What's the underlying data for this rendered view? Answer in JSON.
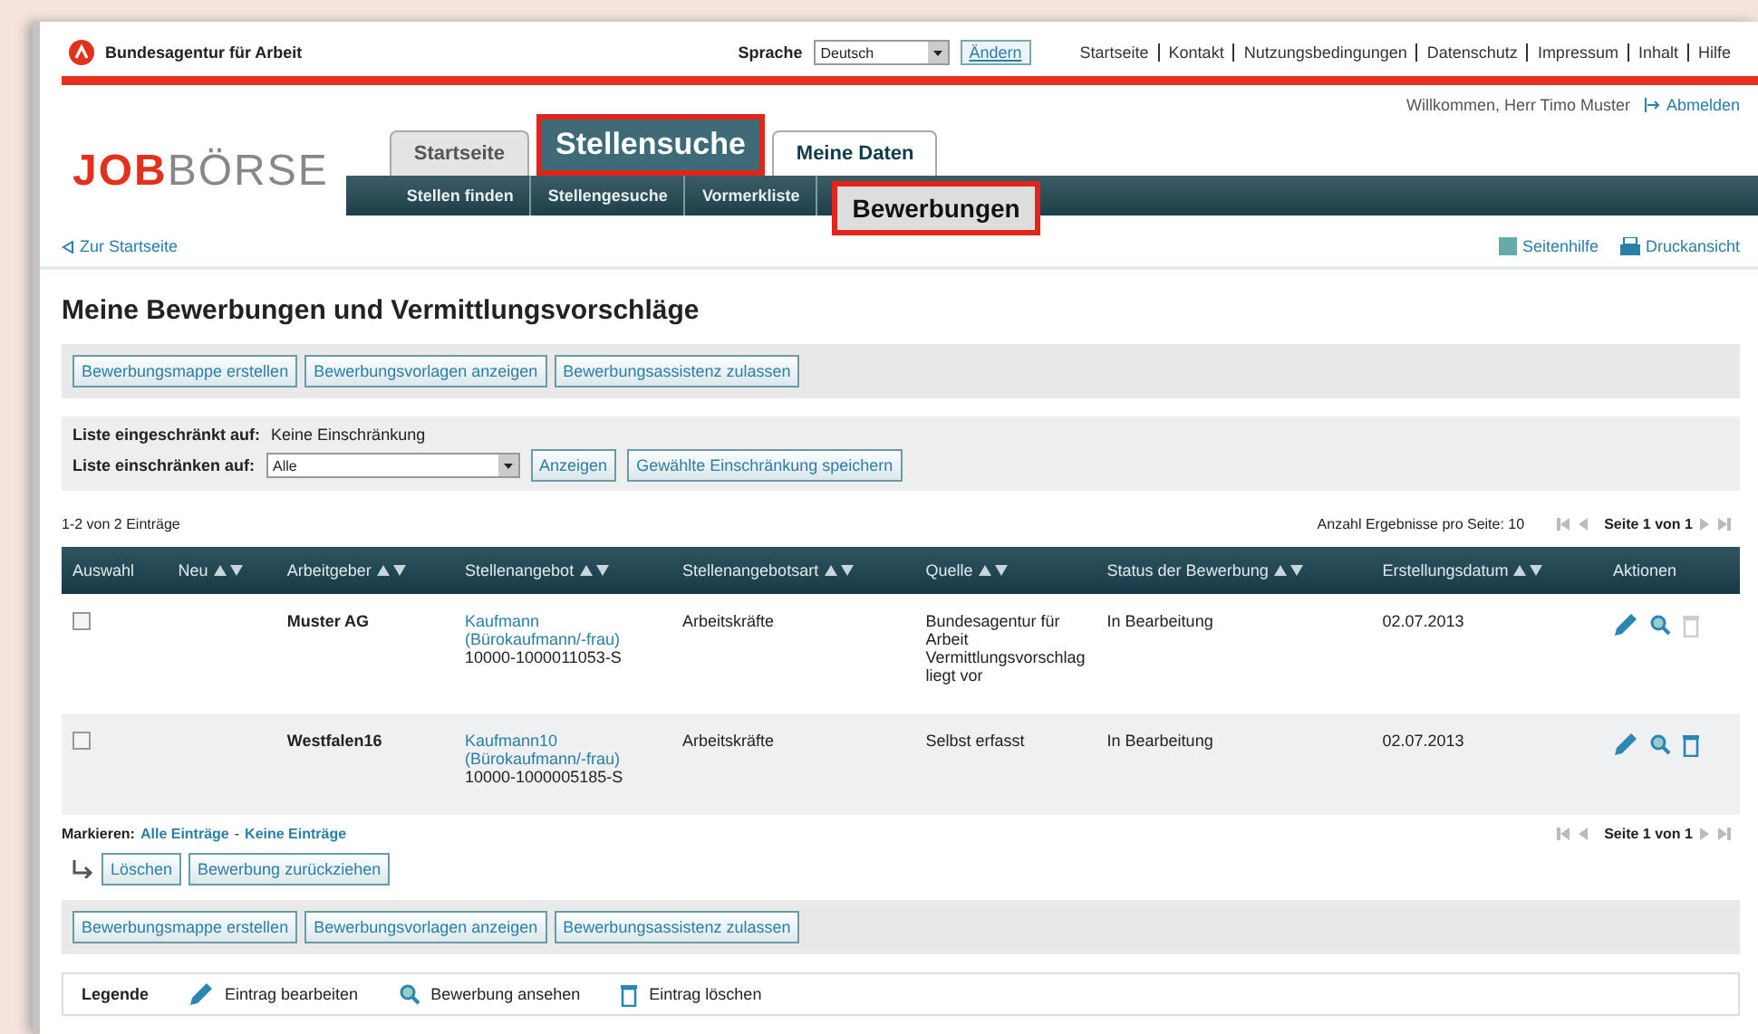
{
  "header": {
    "org": "Bundesagentur für Arbeit",
    "language_label": "Sprache",
    "language_value": "Deutsch",
    "change_button": "Ändern",
    "links": [
      "Startseite",
      "Kontakt",
      "Nutzungsbedingungen",
      "Datenschutz",
      "Impressum",
      "Inhalt",
      "Hilfe"
    ]
  },
  "welcome": {
    "text": "Willkommen, Herr Timo Muster",
    "logout": "Abmelden"
  },
  "logo": {
    "part1": "JOB",
    "part2": "BÖRSE"
  },
  "tabs": [
    {
      "label": "Startseite",
      "selected": false
    },
    {
      "label": "Meine Daten",
      "selected": true
    }
  ],
  "callouts": [
    {
      "label": "Stellensuche"
    },
    {
      "label": "Bewerbungen"
    }
  ],
  "subnav": [
    {
      "label": "Stellen finden"
    },
    {
      "label": "Stellengesuche"
    },
    {
      "label": "Vormerkliste"
    }
  ],
  "back_link": "Zur Startseite",
  "tools": [
    "Seitenhilfe",
    "Druckansicht"
  ],
  "title": "Meine Bewerbungen und Vermittlungsvorschläge",
  "action_buttons_top": [
    "Bewerbungsmappe erstellen",
    "Bewerbungsvorlagen anzeigen",
    "Bewerbungsassistenz zulassen"
  ],
  "filter": {
    "restricted_label": "Liste eingeschränkt auf:",
    "restricted_value": "Keine Einschränkung",
    "restrict_label": "Liste einschränken auf:",
    "select_value": "Alle",
    "show_button": "Anzeigen",
    "save_button": "Gewählte Einschränkung speichern"
  },
  "count": "1-2 von 2 Einträge",
  "per_page": "Anzahl Ergebnisse pro Seite: 10",
  "pager_top": "Seite 1 von 1",
  "pager_bottom": "Seite 1 von 1",
  "table": {
    "columns": [
      {
        "label": "Auswahl",
        "sortable": false
      },
      {
        "label": "Neu",
        "sortable": true
      },
      {
        "label": "Arbeitgeber",
        "sortable": true
      },
      {
        "label": "Stellenangebot",
        "sortable": true
      },
      {
        "label": "Stellenangebotsart",
        "sortable": true
      },
      {
        "label": "Quelle",
        "sortable": true
      },
      {
        "label": "Status der Bewerbung",
        "sortable": true
      },
      {
        "label": "Erstellungsdatum",
        "sortable": true
      },
      {
        "label": "Aktionen",
        "sortable": false
      }
    ],
    "rows": [
      {
        "checked": false,
        "employer": "Muster AG",
        "offer": "Kaufmann (Bürokaufmann/-frau)",
        "ref": "10000-1000011053-S",
        "type": "Arbeitskräfte",
        "source": "Bundesagentur für Arbeit Vermittlungsvorschlag liegt vor",
        "status": "In Bearbeitung",
        "date": "02.07.2013",
        "delete_disabled": true
      },
      {
        "checked": false,
        "employer": "Westfalen16",
        "offer": "Kaufmann10 (Bürokaufmann/-frau)",
        "ref": "10000-1000005185-S",
        "type": "Arbeitskräfte",
        "source": "Selbst erfasst",
        "status": "In Bearbeitung",
        "date": "02.07.2013",
        "delete_disabled": false
      }
    ]
  },
  "mark": {
    "label": "Markieren:",
    "all": "Alle Einträge",
    "separator": "-",
    "none": "Keine Einträge"
  },
  "bulk_buttons": [
    "Löschen",
    "Bewerbung zurückziehen"
  ],
  "action_buttons_bottom": [
    "Bewerbungsmappe erstellen",
    "Bewerbungsvorlagen anzeigen",
    "Bewerbungsassistenz zulassen"
  ],
  "legend": {
    "title": "Legende",
    "items": [
      {
        "kind": "edit",
        "label": "Eintrag bearbeiten"
      },
      {
        "kind": "view",
        "label": "Bewerbung ansehen"
      },
      {
        "kind": "delete",
        "label": "Eintrag löschen"
      }
    ]
  }
}
